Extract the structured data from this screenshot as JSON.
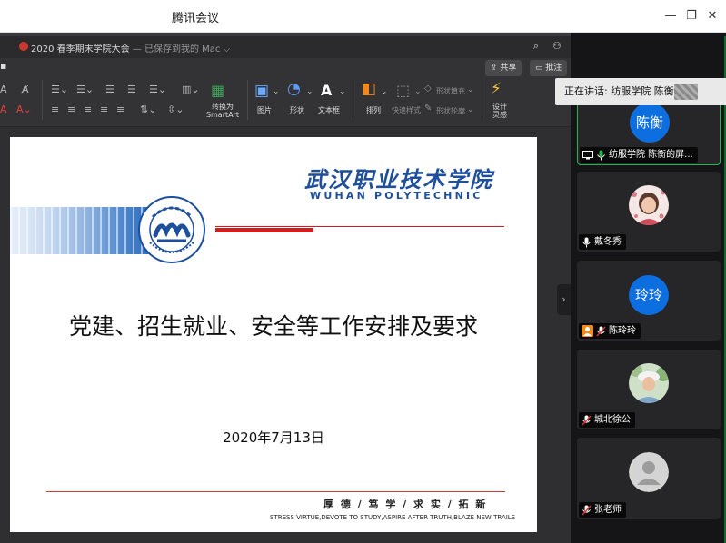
{
  "window": {
    "title": "腾讯会议",
    "minimize": "—",
    "restore": "❐",
    "close": "✕"
  },
  "shared_doc": {
    "title": "2020 春季期末学院大会",
    "subtitle": " — 已保存到我的 Mac ⌵"
  },
  "ribbon": {
    "share_label": "共享",
    "comment_label": "批注",
    "convert_smartart": "转换为\nSmartArt",
    "picture": "图片",
    "shape": "形状",
    "textbox": "文本框",
    "arrange": "排列",
    "quick_style": "快速样式",
    "shape_fill": "形状填充",
    "shape_outline": "形状轮廓",
    "design_ideas": "设计\n灵感"
  },
  "slide": {
    "school_cn": "武汉职业技术学院",
    "school_en": "WUHAN POLYTECHNIC",
    "emblem_text": "WUHAN POLYTECHNIC",
    "heading": "党建、招生就业、安全等工作安排及要求",
    "date": "2020年7月13日",
    "motto_cn": "厚 德 / 笃 学 / 求 实 / 拓 新",
    "motto_en": "STRESS VIRTUE,DEVOTE TO STUDY,ASPIRE AFTER TRUTH,BLAZE NEW TRAILS"
  },
  "panel": {
    "speaking_label": "正在讲话: 纺服学院 陈衡;",
    "participants": [
      {
        "avatar_text": "陈衡",
        "name": "纺服学院 陈衡的屏...",
        "avatar_color": "#0d6ee0"
      },
      {
        "avatar_text": "",
        "name": "戴冬秀"
      },
      {
        "avatar_text": "玲玲",
        "name": "陈玲玲",
        "avatar_color": "#0d6ee0"
      },
      {
        "avatar_text": "",
        "name": "城北徐公"
      },
      {
        "avatar_text": "",
        "name": "张老师"
      }
    ]
  },
  "colors": {
    "speaking_border": "#1fba4a",
    "school_blue": "#1e4f9c",
    "accent_red": "#cf1f1f"
  }
}
